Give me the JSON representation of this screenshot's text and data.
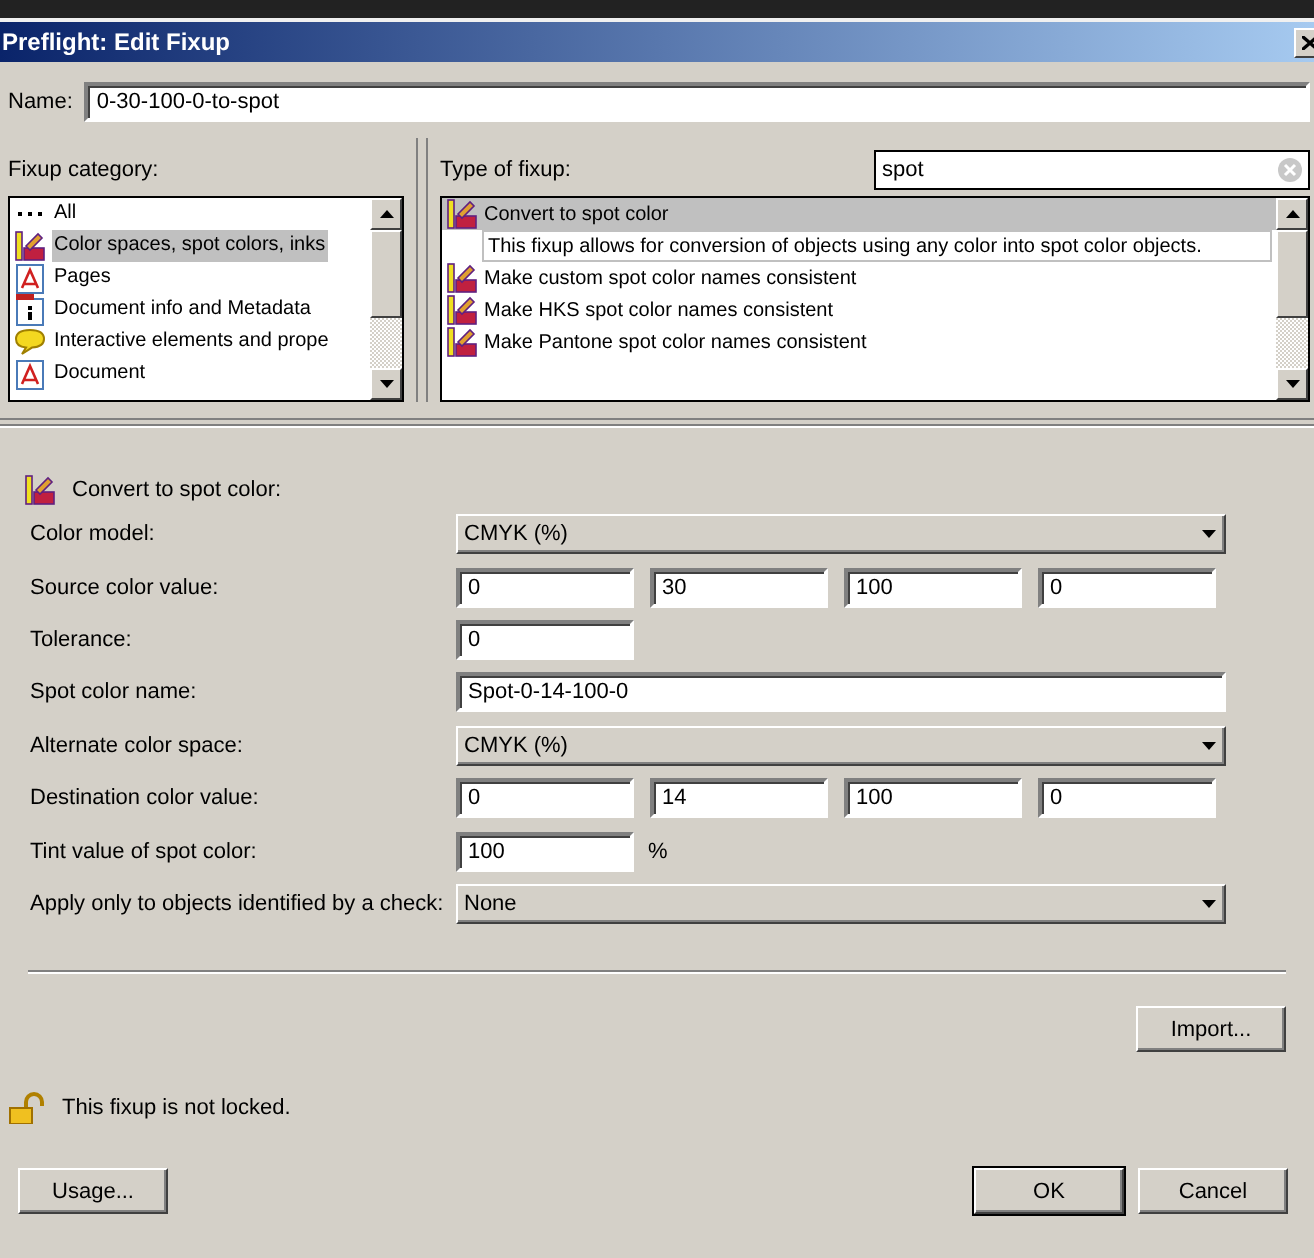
{
  "window": {
    "title": "Preflight: Edit Fixup"
  },
  "name": {
    "label": "Name:",
    "value": "0-30-100-0-to-spot"
  },
  "category": {
    "label": "Fixup category:",
    "items": [
      {
        "label": "All",
        "kind": "dots",
        "selected": false
      },
      {
        "label": "Color spaces, spot colors, inks",
        "kind": "swatch",
        "selected": true
      },
      {
        "label": "Pages",
        "kind": "pdf",
        "selected": false
      },
      {
        "label": "Document info and Metadata",
        "kind": "info",
        "selected": false
      },
      {
        "label": "Interactive elements and prope",
        "kind": "comment",
        "selected": false
      },
      {
        "label": "Document",
        "kind": "pdf",
        "selected": false
      }
    ]
  },
  "fixup_type": {
    "label": "Type of fixup:",
    "search": {
      "value": "spot"
    },
    "items": [
      {
        "label": "Convert to spot color",
        "selected": true,
        "description": "This fixup allows for conversion of objects using any color into spot color objects."
      },
      {
        "label": "Make custom spot color names consistent",
        "selected": false
      },
      {
        "label": "Make HKS spot color names consistent",
        "selected": false
      },
      {
        "label": "Make Pantone spot color names consistent",
        "selected": false
      }
    ]
  },
  "details": {
    "title": "Convert to spot color:",
    "rows": [
      {
        "kind": "select",
        "label": "Color model:",
        "value": "CMYK (%)"
      },
      {
        "kind": "fields",
        "label": "Source color value:",
        "values": [
          "0",
          "30",
          "100",
          "0"
        ]
      },
      {
        "kind": "fields",
        "label": "Tolerance:",
        "values": [
          "0"
        ]
      },
      {
        "kind": "text",
        "label": "Spot color name:",
        "value": "Spot-0-14-100-0"
      },
      {
        "kind": "select",
        "label": "Alternate color space:",
        "value": "CMYK (%)"
      },
      {
        "kind": "fields",
        "label": "Destination color value:",
        "values": [
          "0",
          "14",
          "100",
          "0"
        ]
      },
      {
        "kind": "fields",
        "label": "Tint value of spot color:",
        "values": [
          "100"
        ],
        "unit": "%"
      },
      {
        "kind": "select",
        "label": "Apply only to objects identified by a check:",
        "value": "None"
      }
    ]
  },
  "import_button": "Import...",
  "lock": {
    "locked": false,
    "text": "This fixup is not locked."
  },
  "usage_button": "Usage...",
  "buttons": [
    {
      "label": "OK",
      "default": true
    },
    {
      "label": "Cancel",
      "default": false
    }
  ]
}
